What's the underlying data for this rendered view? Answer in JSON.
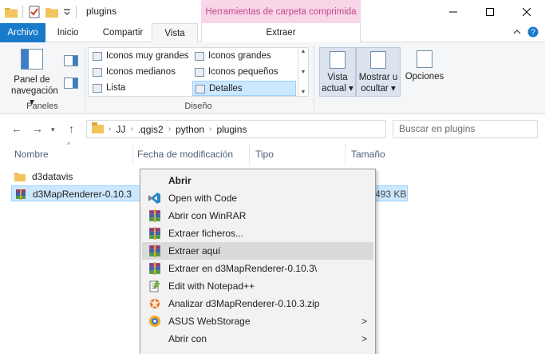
{
  "window": {
    "title": "plugins",
    "contextual_tab_title": "Herramientas de carpeta comprimida"
  },
  "tabs": [
    "Archivo",
    "Inicio",
    "Compartir",
    "Vista",
    "Extraer"
  ],
  "ribbon": {
    "panes": {
      "nav_pane_label_line1": "Panel de",
      "nav_pane_label_line2": "navegación",
      "group": "Paneles"
    },
    "layout": {
      "items": [
        "Iconos muy grandes",
        "Iconos grandes",
        "Iconos medianos",
        "Iconos pequeños",
        "Lista",
        "Detalles"
      ],
      "selected": "Detalles",
      "group": "Diseño"
    },
    "current_view": {
      "line1": "Vista",
      "line2": "actual"
    },
    "show_hide": {
      "line1": "Mostrar u",
      "line2": "ocultar"
    },
    "options": "Opciones"
  },
  "address": {
    "crumbs": [
      "JJ",
      ".qgis2",
      "python",
      "plugins"
    ],
    "search_placeholder": "Buscar en plugins"
  },
  "columns": [
    "Nombre",
    "Fecha de modificación",
    "Tipo",
    "Tamaño"
  ],
  "files": [
    {
      "name": "d3datavis",
      "size": ""
    },
    {
      "name": "d3MapRenderer-0.10.3",
      "size": "493 KB",
      "selected": true
    }
  ],
  "context_menu": [
    {
      "label": "Abrir",
      "bold": true,
      "icon": "none"
    },
    {
      "label": "Open with Code",
      "icon": "vscode-icon"
    },
    {
      "label": "Abrir con WinRAR",
      "icon": "winrar-icon"
    },
    {
      "label": "Extraer ficheros...",
      "icon": "winrar-icon"
    },
    {
      "label": "Extraer aquí",
      "icon": "winrar-icon",
      "hover": true
    },
    {
      "label": "Extraer en d3MapRenderer-0.10.3\\",
      "icon": "winrar-icon"
    },
    {
      "label": "Edit with Notepad++",
      "icon": "notepadpp-icon"
    },
    {
      "label": "Analizar d3MapRenderer-0.10.3.zip",
      "icon": "avast-icon"
    },
    {
      "label": "ASUS WebStorage",
      "icon": "asus-webstorage-icon",
      "submenu": true
    },
    {
      "label": "Abrir con",
      "icon": "none",
      "submenu": true
    }
  ],
  "colors": {
    "accent": "#1979ca",
    "contextual_tab": "#f9d5e8",
    "selection": "#cce8ff",
    "menu_bg": "#f2f2f2"
  }
}
